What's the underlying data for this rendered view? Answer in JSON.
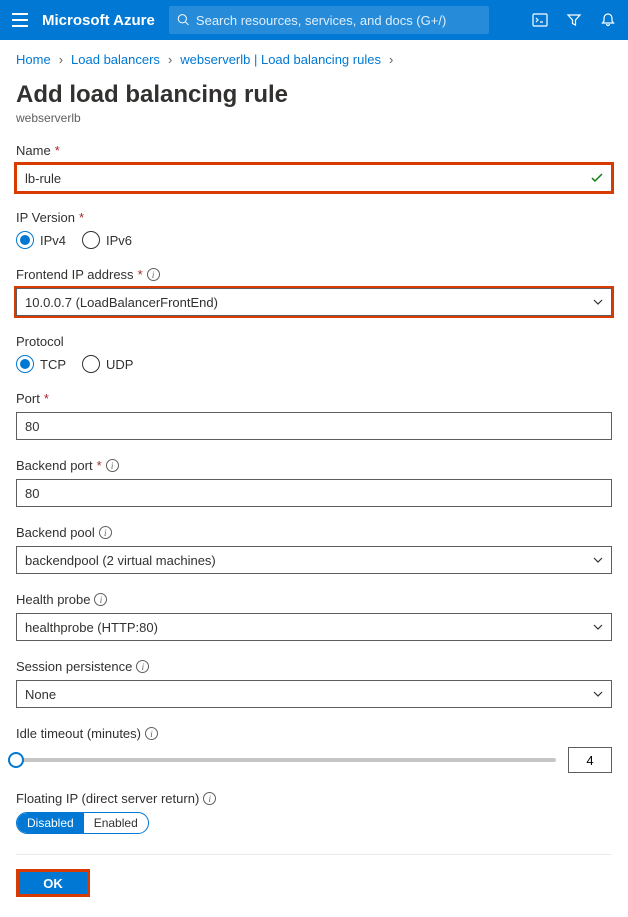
{
  "topbar": {
    "brand": "Microsoft Azure",
    "searchPlaceholder": "Search resources, services, and docs (G+/)"
  },
  "breadcrumb": {
    "home": "Home",
    "lb": "Load balancers",
    "rules": "webserverlb | Load balancing rules"
  },
  "page": {
    "title": "Add load balancing rule",
    "subtitle": "webserverlb"
  },
  "fields": {
    "name": {
      "label": "Name",
      "value": "lb-rule"
    },
    "ipversion": {
      "label": "IP Version",
      "opt1": "IPv4",
      "opt2": "IPv6"
    },
    "frontend": {
      "label": "Frontend IP address",
      "value": "10.0.0.7 (LoadBalancerFrontEnd)"
    },
    "protocol": {
      "label": "Protocol",
      "opt1": "TCP",
      "opt2": "UDP"
    },
    "port": {
      "label": "Port",
      "value": "80"
    },
    "backendport": {
      "label": "Backend port",
      "value": "80"
    },
    "backendpool": {
      "label": "Backend pool",
      "value": "backendpool (2 virtual machines)"
    },
    "healthprobe": {
      "label": "Health probe",
      "value": "healthprobe (HTTP:80)"
    },
    "session": {
      "label": "Session persistence",
      "value": "None"
    },
    "idle": {
      "label": "Idle timeout (minutes)",
      "value": "4"
    },
    "floating": {
      "label": "Floating IP (direct server return)",
      "disabled": "Disabled",
      "enabled": "Enabled"
    }
  },
  "buttons": {
    "ok": "OK"
  }
}
